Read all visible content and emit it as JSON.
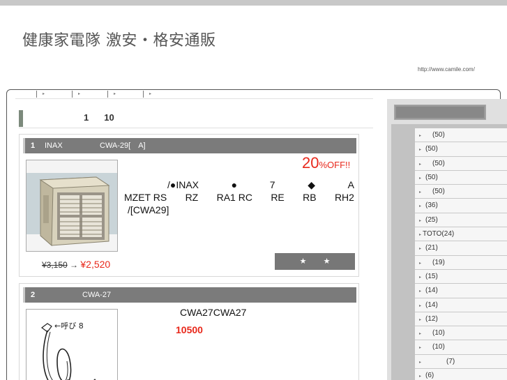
{
  "site": {
    "title": "健康家電隊 激安・格安通販",
    "url": "http://www.camile.com/"
  },
  "nav": {
    "items": [
      {
        "label": "▸"
      },
      {
        "label": "▸"
      },
      {
        "label": "▸"
      },
      {
        "label": "▸"
      }
    ]
  },
  "ranking": {
    "heading_rank": "1",
    "heading_count": "10"
  },
  "products": [
    {
      "rank": "1",
      "maker": "INAX",
      "model": "CWA-29[　A]",
      "discount_num": "20",
      "discount_unit": "%OFF!!",
      "desc_l1": [
        "/●INAX",
        "●",
        "7",
        "◆",
        "A"
      ],
      "desc_l2": [
        "MZET RS",
        "RZ",
        "RA1 RC",
        "RE",
        "RB",
        "RH2"
      ],
      "desc_l3": "/[CWA29]",
      "price_old": "¥3,150",
      "price_arrow": " → ",
      "price_new": "¥2,520",
      "rating": [
        "★",
        "★"
      ]
    },
    {
      "rank": "2",
      "maker": "",
      "model": "CWA-27",
      "title": "CWA27CWA27",
      "price": "10500",
      "image_caption": "←呼び 8"
    }
  ],
  "sidebar": {
    "items": [
      {
        "label": "　(50)"
      },
      {
        "label": "(50)"
      },
      {
        "label": "　(50)"
      },
      {
        "label": "(50)"
      },
      {
        "label": "　(50)"
      },
      {
        "label": "(36)"
      },
      {
        "label": "(25)"
      },
      {
        "label": "TOTO(24)"
      },
      {
        "label": "(21)"
      },
      {
        "label": "　(19)"
      },
      {
        "label": "(15)"
      },
      {
        "label": "(14)"
      },
      {
        "label": "(14)"
      },
      {
        "label": "(12)"
      },
      {
        "label": "　(10)"
      },
      {
        "label": "　(10)"
      },
      {
        "label": "　　　(7)"
      },
      {
        "label": "(6)"
      }
    ]
  },
  "colors": {
    "accent_red": "#e8281b",
    "header_gray": "#7b7b7b",
    "sidebar_bg": "#c2c2c2"
  }
}
